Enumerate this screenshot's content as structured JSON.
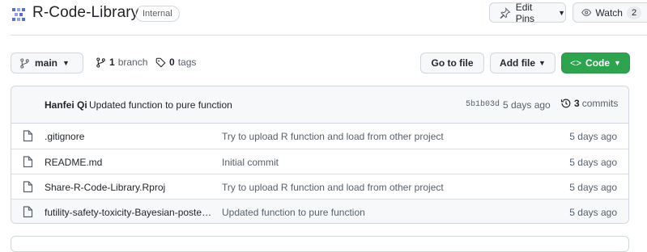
{
  "header": {
    "repo_name": "R-Code-Library",
    "visibility_badge": "Internal",
    "edit_pins_label": "Edit Pins",
    "watch_label": "Watch",
    "watch_count": "2"
  },
  "toolbar": {
    "branch_name": "main",
    "branch_count": "1",
    "branch_word": "branch",
    "tag_count": "0",
    "tag_word": "tags",
    "go_to_file_label": "Go to file",
    "add_file_label": "Add file",
    "code_label": "Code"
  },
  "latest_commit": {
    "author": "Hanfei Qi",
    "message": "Updated function to pure function",
    "sha": "5b1b03d",
    "age": "5 days ago",
    "commit_count": "3",
    "commit_word": "commits"
  },
  "files": [
    {
      "name": ".gitignore",
      "message": "Try to upload R function and load from other project",
      "age": "5 days ago"
    },
    {
      "name": "README.md",
      "message": "Initial commit",
      "age": "5 days ago"
    },
    {
      "name": "Share-R-Code-Library.Rproj",
      "message": "Try to upload R function and load from other project",
      "age": "5 days ago"
    },
    {
      "name": "futility-safety-toxicity-Bayesian-poste…",
      "message": "Updated function to pure function",
      "age": "5 days ago"
    }
  ],
  "colors": {
    "code_button": "#2da44e",
    "repo_icon": "#5a6fd6"
  },
  "icons": [
    "repo-icon",
    "pin-icon",
    "eye-icon",
    "branch-icon",
    "tag-icon",
    "history-icon",
    "file-icon",
    "caret-down-icon",
    "code-icon"
  ]
}
